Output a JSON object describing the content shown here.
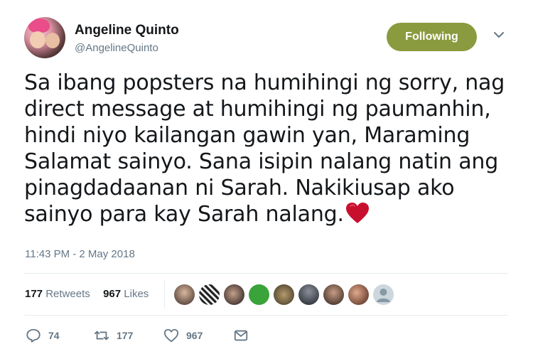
{
  "user": {
    "name": "Angeline Quinto",
    "handle": "@AngelineQuinto"
  },
  "follow_button": {
    "label": "Following",
    "color": "#8a9a3e"
  },
  "tweet": {
    "lines": [
      "Sa ibang popsters na humihingi ng sorry, nag",
      "direct message at humihingi ng paumanhin,",
      "hindi niyo kailangan gawin yan, Maraming",
      "Salamat sainyo. Sana isipin nalang natin ang",
      "pinagdadaanan ni Sarah. Nakikiusap ako",
      "sainyo para kay Sarah nalang."
    ],
    "emoji": "red-heart",
    "timestamp": "11:43 PM - 2 May 2018"
  },
  "stats": {
    "retweets_count": "177",
    "retweets_label": "Retweets",
    "likes_count": "967",
    "likes_label": "Likes",
    "likers_icons": [
      "avatar-1",
      "avatar-2",
      "avatar-3",
      "avatar-4",
      "avatar-5",
      "avatar-6",
      "avatar-7",
      "avatar-8",
      "avatar-9",
      "avatar-default"
    ]
  },
  "actions": {
    "reply_count": "74",
    "retweet_count": "177",
    "like_count": "967"
  },
  "colors": {
    "text": "#14171a",
    "secondary": "#657786",
    "divider": "#e6ecf0",
    "heart": "#c8102e"
  }
}
